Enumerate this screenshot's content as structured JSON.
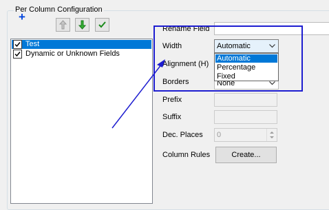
{
  "group": {
    "title": "Per Column Configuration"
  },
  "toolbar": {
    "add_icon": "plus-icon",
    "up_icon": "arrow-up-icon",
    "down_icon": "arrow-down-icon",
    "check_icon": "check-icon"
  },
  "fields_list": {
    "items": [
      {
        "label": "Test",
        "checked": true,
        "selected": true
      },
      {
        "label": "Dynamic or Unknown Fields",
        "checked": true,
        "selected": false
      }
    ]
  },
  "form": {
    "rename_label": "Rename Field",
    "rename_value": "",
    "width_label": "Width",
    "width_value": "Automatic",
    "width_options": [
      "Automatic",
      "Percentage",
      "Fixed"
    ],
    "alignment_label": "Alignment (H)",
    "borders_label": "Borders",
    "borders_value": "None",
    "prefix_label": "Prefix",
    "suffix_label": "Suffix",
    "dec_places_label": "Dec. Places",
    "dec_places_value": "0",
    "column_rules_label": "Column Rules",
    "create_button": "Create..."
  },
  "colors": {
    "selection": "#0078d7",
    "annotation": "#1d1dd0",
    "add_icon": "#0044dd",
    "green_icon": "#1fa01f"
  }
}
